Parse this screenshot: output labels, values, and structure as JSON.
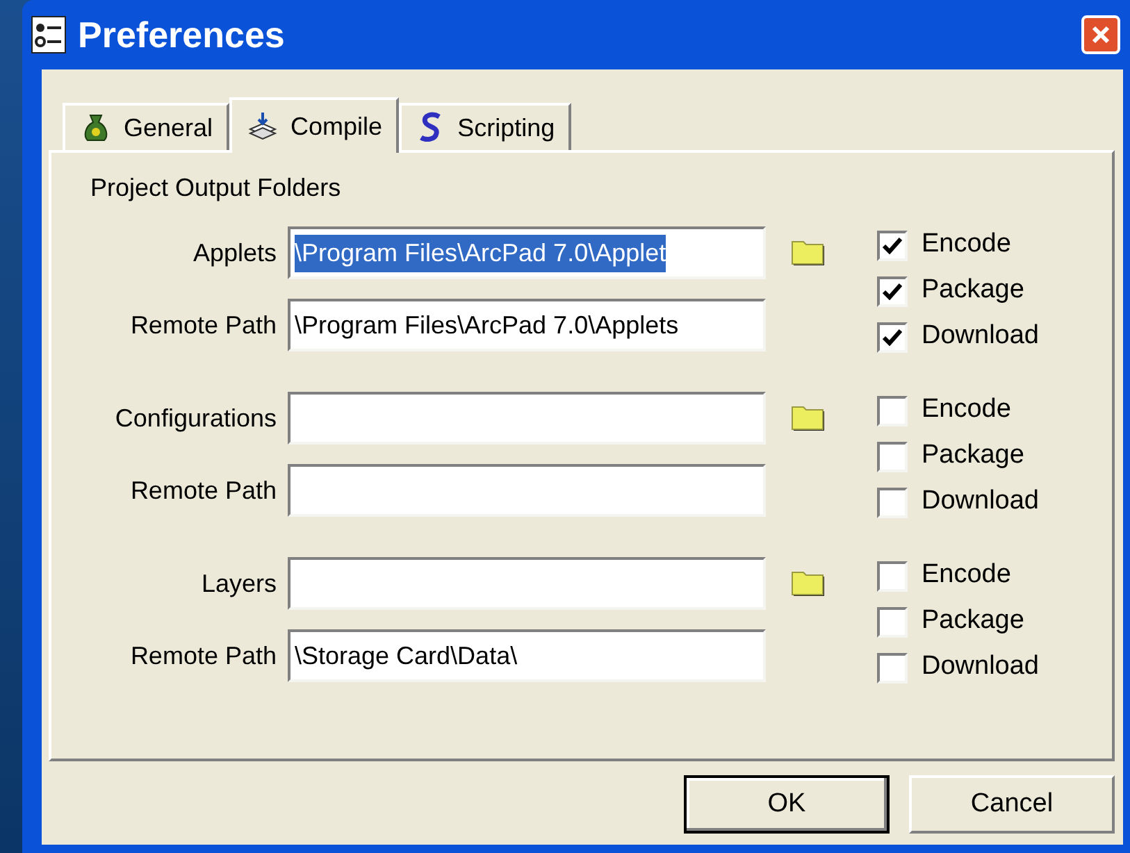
{
  "window": {
    "title": "Preferences"
  },
  "tabs": [
    {
      "label": "General",
      "selected": false,
      "kind": "general"
    },
    {
      "label": "Compile",
      "selected": true,
      "kind": "compile"
    },
    {
      "label": "Scripting",
      "selected": false,
      "kind": "scripting"
    }
  ],
  "section_title": "Project Output Folders",
  "groups": [
    {
      "label": "Applets",
      "value": "\\Program Files\\ArcPad 7.0\\Applet",
      "value_selected": true,
      "remote_label": "Remote Path",
      "remote_value": "\\Program Files\\ArcPad 7.0\\Applets",
      "options": [
        {
          "label": "Encode",
          "checked": true
        },
        {
          "label": "Package",
          "checked": true
        },
        {
          "label": "Download",
          "checked": true
        }
      ]
    },
    {
      "label": "Configurations",
      "remote_label": "Remote Path",
      "options": [
        {
          "label": "Encode",
          "checked": false
        },
        {
          "label": "Package",
          "checked": false
        },
        {
          "label": "Download",
          "checked": false
        }
      ]
    },
    {
      "label": "Layers",
      "remote_label": "Remote Path",
      "remote_value": "\\Storage Card\\Data\\",
      "options": [
        {
          "label": "Encode",
          "checked": false
        },
        {
          "label": "Package",
          "checked": false
        },
        {
          "label": "Download",
          "checked": false
        }
      ]
    }
  ],
  "buttons": [
    {
      "label": "OK",
      "kind": "default"
    },
    {
      "label": "Cancel",
      "kind": "normal"
    }
  ]
}
